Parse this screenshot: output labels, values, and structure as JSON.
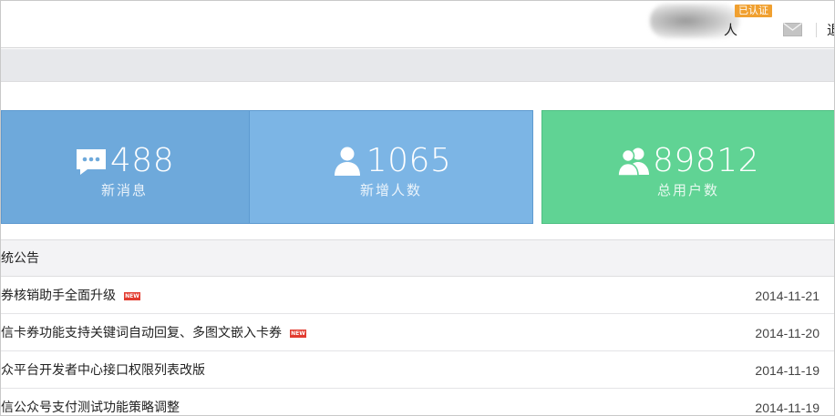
{
  "header": {
    "verify_badge": "已认证",
    "user_name": "人",
    "logout_label": "退"
  },
  "stats": [
    {
      "value": "488",
      "label": "新消息",
      "icon": "message-icon",
      "color": "#6ea9db"
    },
    {
      "value": "1065",
      "label": "新增人数",
      "icon": "user-icon",
      "color": "#7cb5e5"
    },
    {
      "value": "89812",
      "label": "总用户数",
      "icon": "users-icon",
      "color": "#60d394"
    }
  ],
  "notices": {
    "title": "统公告",
    "items": [
      {
        "text": "券核销助手全面升级",
        "is_new": true,
        "new_label": "NEW",
        "date": "2014-11-21"
      },
      {
        "text": "信卡券功能支持关键词自动回复、多图文嵌入卡券",
        "is_new": true,
        "new_label": "NEW",
        "date": "2014-11-20"
      },
      {
        "text": "众平台开发者中心接口权限列表改版",
        "is_new": false,
        "new_label": "",
        "date": "2014-11-19"
      },
      {
        "text": "信公众号支付测试功能策略调整",
        "is_new": false,
        "new_label": "",
        "date": "2014-11-19"
      }
    ]
  }
}
